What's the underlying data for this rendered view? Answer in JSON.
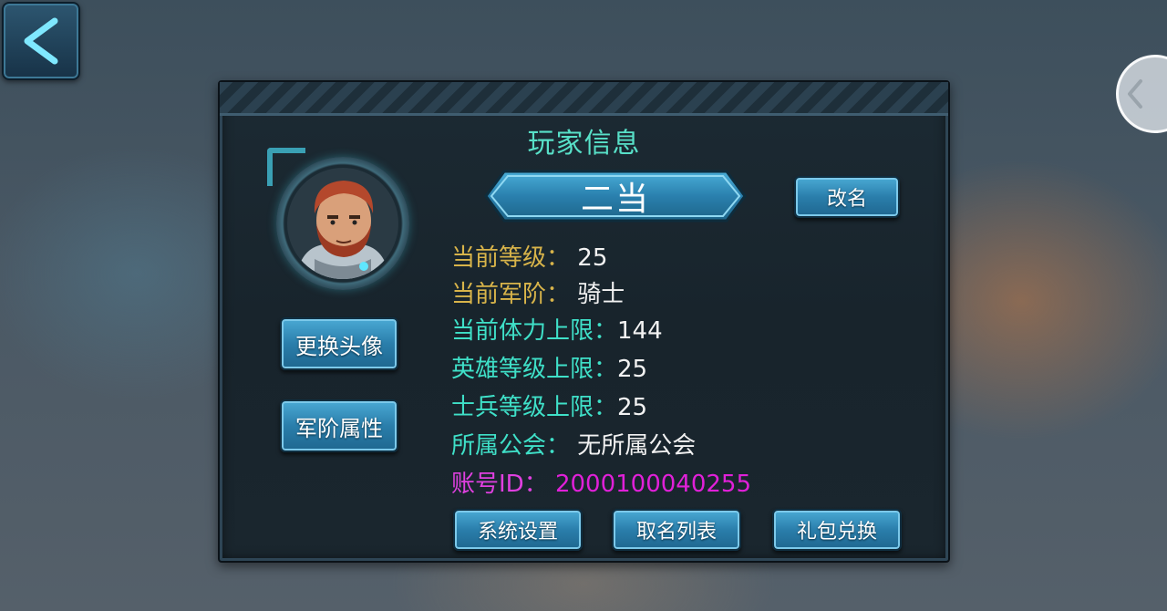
{
  "panel": {
    "title": "玩家信息",
    "player_name": "二当",
    "rename_label": "改名",
    "change_avatar_label": "更换头像",
    "rank_attributes_label": "军阶属性"
  },
  "info": {
    "level_label": "当前等级：",
    "level_value": "25",
    "rank_label": "当前军阶：",
    "rank_value": "骑士",
    "stamina_label": "当前体力上限：",
    "stamina_value": "144",
    "hero_level_label": "英雄等级上限：",
    "hero_level_value": "25",
    "soldier_level_label": "士兵等级上限：",
    "soldier_level_value": "25",
    "guild_label": "所属公会：",
    "guild_value": "无所属公会",
    "account_label": "账号ID：",
    "account_value": "2000100040255"
  },
  "footer": {
    "settings_label": "系统设置",
    "name_list_label": "取名列表",
    "gift_redeem_label": "礼包兑换"
  },
  "icons": {
    "back": "chevron-left-icon",
    "side": "chevron-left-icon"
  },
  "colors": {
    "title": "#58e0c8",
    "gold_label": "#d8b44a",
    "cyan_label": "#3fe0c8",
    "account_id": "#e020d8",
    "button": "#2a7eab"
  }
}
